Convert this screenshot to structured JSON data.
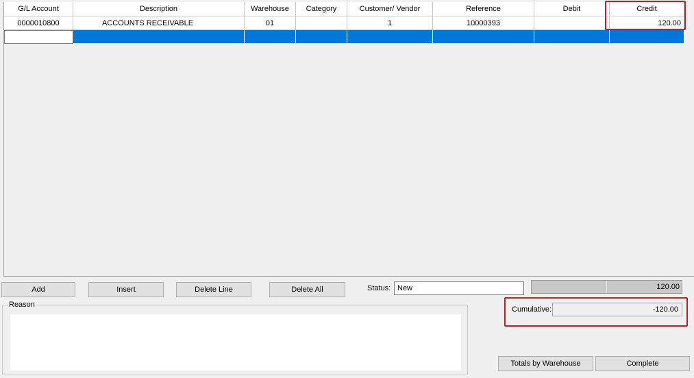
{
  "grid": {
    "columns": [
      "G/L Account",
      "Description",
      "Warehouse",
      "Category",
      "Customer/ Vendor",
      "Reference",
      "Debit",
      "Credit"
    ],
    "row": {
      "gl_account": "0000010800",
      "description": "ACCOUNTS RECEIVABLE",
      "warehouse": "01",
      "category": "",
      "customer_vendor": "1",
      "reference": "10000393",
      "debit": "",
      "credit": "120.00"
    }
  },
  "buttons": {
    "add": "Add",
    "insert": "Insert",
    "delete_line": "Delete Line",
    "delete_all": "Delete All",
    "totals_by_warehouse": "Totals by Warehouse",
    "complete": "Complete"
  },
  "status": {
    "label": "Status:",
    "value": "New"
  },
  "totals": {
    "debit_total": "",
    "credit_total": "120.00"
  },
  "reason": {
    "label": "Reason",
    "value": ""
  },
  "cumulative": {
    "label": "Cumulative:",
    "value": "-120.00"
  },
  "colors": {
    "selection": "#0078d7",
    "highlight": "#b8202c"
  }
}
